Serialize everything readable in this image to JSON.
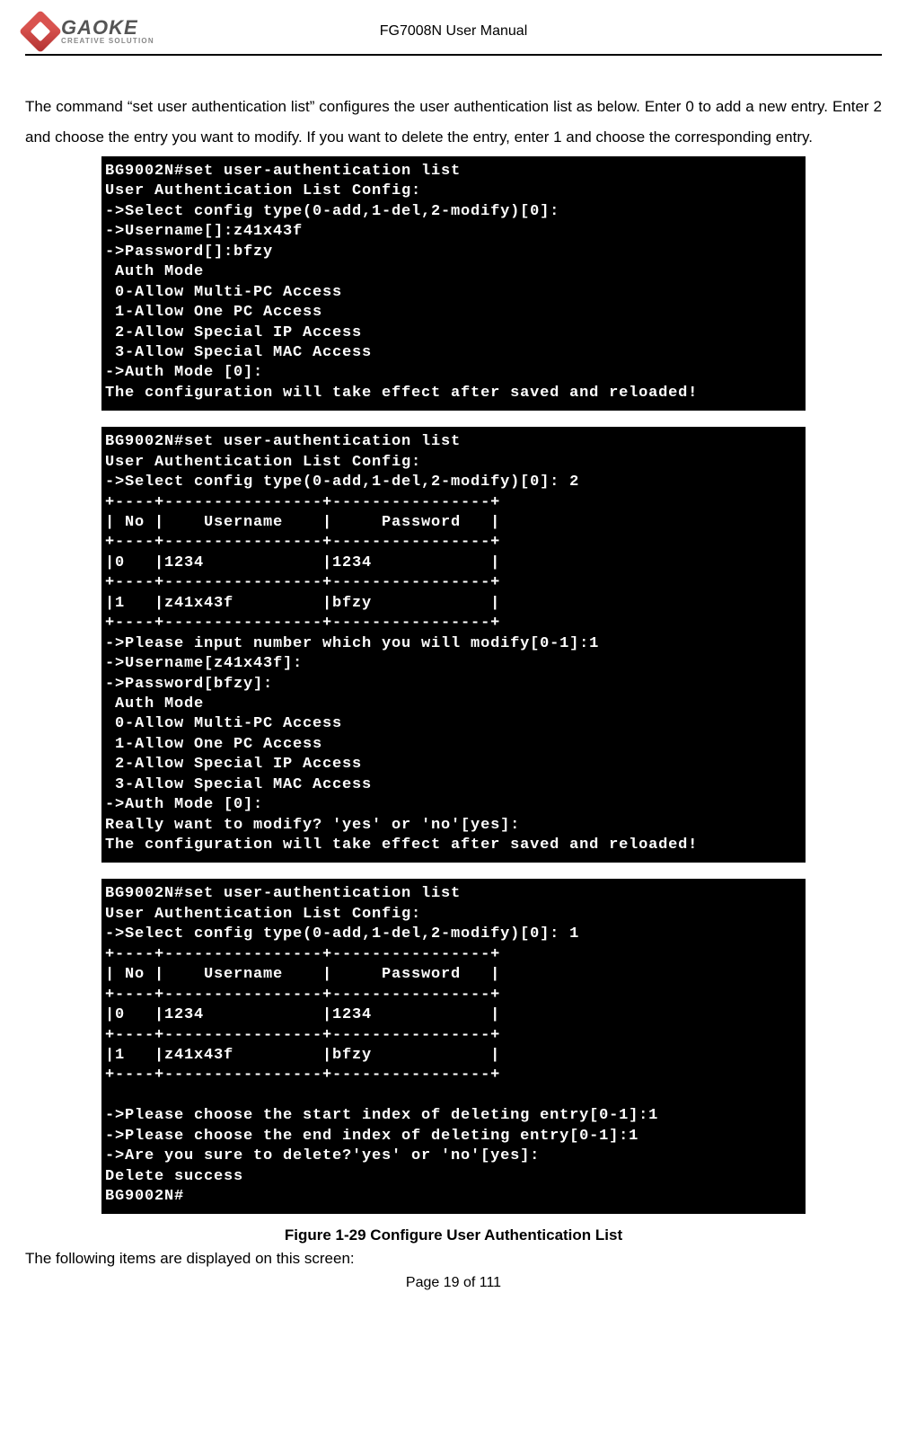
{
  "header": {
    "brand": "GAOKE",
    "tagline": "CREATIVE SOLUTION",
    "doc_title": "FG7008N User Manual"
  },
  "paragraph": "The command “set user authentication list” configures the user authentication list as below. Enter 0 to add a new entry. Enter 2 and choose the entry you want to modify. If you want to delete the entry, enter 1 and choose the corresponding entry.",
  "terminals": {
    "t1": "BG9002N#set user-authentication list\nUser Authentication List Config:\n->Select config type(0-add,1-del,2-modify)[0]:\n->Username[]:z41x43f\n->Password[]:bfzy\n Auth Mode\n 0-Allow Multi-PC Access\n 1-Allow One PC Access\n 2-Allow Special IP Access\n 3-Allow Special MAC Access\n->Auth Mode [0]:\nThe configuration will take effect after saved and reloaded!",
    "t2": "BG9002N#set user-authentication list\nUser Authentication List Config:\n->Select config type(0-add,1-del,2-modify)[0]: 2\n+----+----------------+----------------+\n| No |    Username    |     Password   |\n+----+----------------+----------------+\n|0   |1234            |1234            |\n+----+----------------+----------------+\n|1   |z41x43f         |bfzy            |\n+----+----------------+----------------+\n->Please input number which you will modify[0-1]:1\n->Username[z41x43f]:\n->Password[bfzy]:\n Auth Mode\n 0-Allow Multi-PC Access\n 1-Allow One PC Access\n 2-Allow Special IP Access\n 3-Allow Special MAC Access\n->Auth Mode [0]:\nReally want to modify? 'yes' or 'no'[yes]:\nThe configuration will take effect after saved and reloaded!",
    "t3": "BG9002N#set user-authentication list\nUser Authentication List Config:\n->Select config type(0-add,1-del,2-modify)[0]: 1\n+----+----------------+----------------+\n| No |    Username    |     Password   |\n+----+----------------+----------------+\n|0   |1234            |1234            |\n+----+----------------+----------------+\n|1   |z41x43f         |bfzy            |\n+----+----------------+----------------+\n\n->Please choose the start index of deleting entry[0-1]:1\n->Please choose the end index of deleting entry[0-1]:1\n->Are you sure to delete?'yes' or 'no'[yes]:\nDelete success\nBG9002N#"
  },
  "figure_caption": "Figure 1-29    Configure User Authentication List",
  "post_text": "The following items are displayed on this screen:",
  "footer": "Page 19 of 111"
}
